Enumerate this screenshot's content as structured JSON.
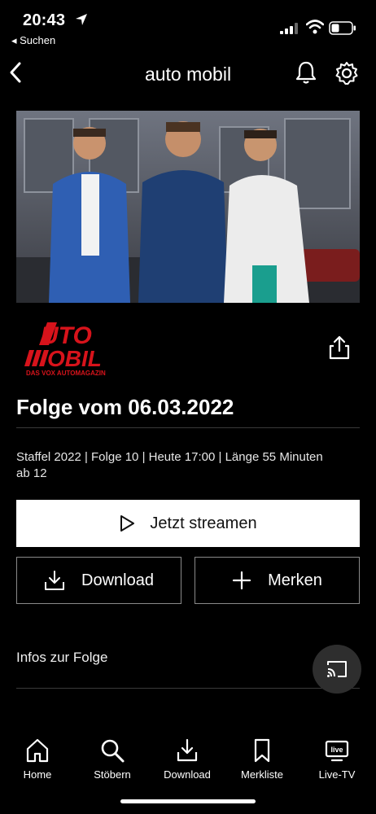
{
  "status_bar": {
    "time": "20:43",
    "back_app": "◂ Suchen"
  },
  "header": {
    "title": "auto mobil"
  },
  "show": {
    "logo_text_main": "AUTO MOBIL",
    "logo_tagline": "DAS VOX AUTOMAGAZIN",
    "episode_title": "Folge vom 06.03.2022",
    "meta_line1": "Staffel 2022 | Folge 10 | Heute 17:00 | Länge 55 Minuten",
    "meta_line2": "ab 12"
  },
  "actions": {
    "stream_label": "Jetzt streamen",
    "download_label": "Download",
    "watchlist_label": "Merken"
  },
  "sections": {
    "infos_label": "Infos zur Folge"
  },
  "tabs": [
    {
      "label": "Home",
      "icon": "home-icon"
    },
    {
      "label": "Stöbern",
      "icon": "search-icon"
    },
    {
      "label": "Download",
      "icon": "download-icon"
    },
    {
      "label": "Merkliste",
      "icon": "bookmark-icon"
    },
    {
      "label": "Live-TV",
      "icon": "live-tv-icon"
    }
  ],
  "colors": {
    "background": "#000000",
    "accent_logo": "#d7131b",
    "primary_button": "#ffffff"
  }
}
